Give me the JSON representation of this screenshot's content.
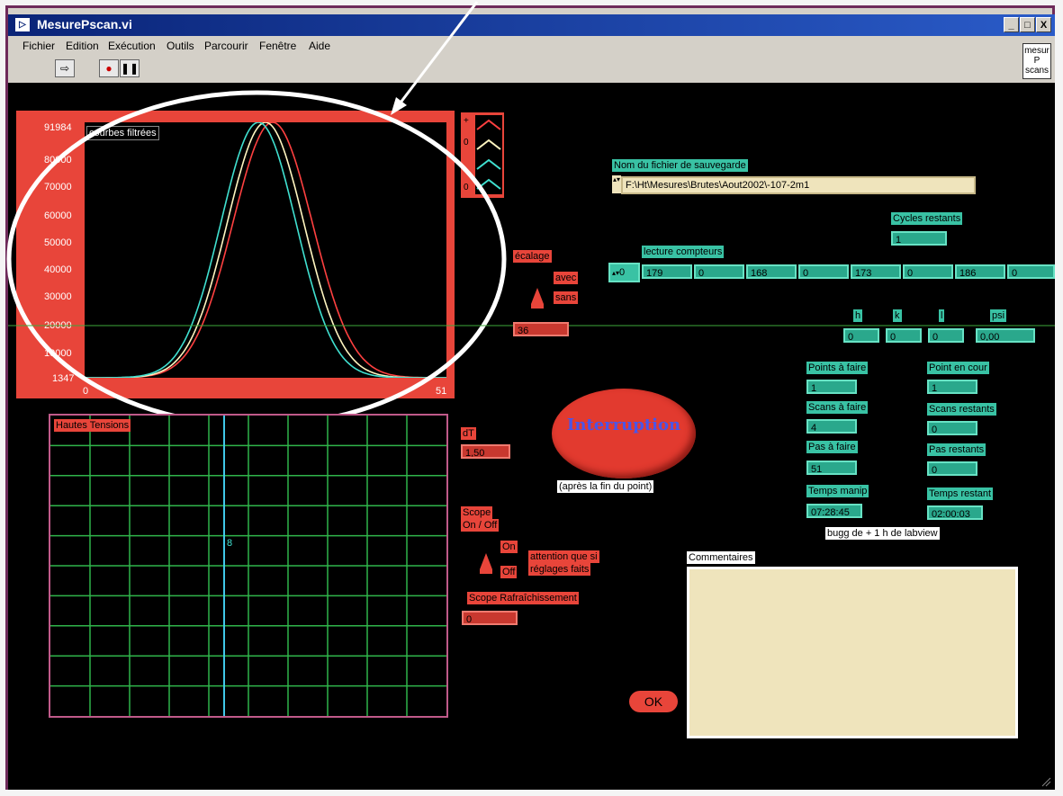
{
  "window": {
    "title": "MesurePscan.vi",
    "minimize_label": "_",
    "maximize_label": "□",
    "close_label": "X"
  },
  "menu": [
    "Fichier",
    "Edition",
    "Exécution",
    "Outils",
    "Parcourir",
    "Fenêtre",
    "Aide"
  ],
  "toolbar": {
    "run_icon": "run-arrow-icon",
    "abort_icon": "abort-icon",
    "pause_icon": "pause-icon",
    "vi_icon_text": [
      "mesur",
      "P",
      "scans"
    ]
  },
  "graph": {
    "title": "courbes filtrées",
    "y_ticks": [
      "91984",
      "80000",
      "70000",
      "60000",
      "50000",
      "40000",
      "30000",
      "20000",
      "10000",
      "1347"
    ],
    "x_ticks": [
      "0",
      "51"
    ],
    "legend_values": [
      "+",
      "0",
      "",
      "0"
    ]
  },
  "chart_data": {
    "type": "line",
    "title": "courbes filtrées",
    "xlim": [
      0,
      51
    ],
    "ylim": [
      1347,
      91984
    ],
    "series": [
      {
        "color": "#ff4040",
        "center": 26.5,
        "width": 5.6
      },
      {
        "color": "#fff5c0",
        "center": 25.5,
        "width": 5.4
      },
      {
        "color": "#40e0d0",
        "center": 24.5,
        "width": 5.3
      }
    ],
    "peak": 91984,
    "baseline": 1347
  },
  "hv": {
    "title": "Hautes Tensions",
    "marker_text": "8"
  },
  "decalage": {
    "label": "écalage",
    "avec": "avec",
    "sans": "sans",
    "value": "36"
  },
  "dt": {
    "label": "dT",
    "value": "1,50"
  },
  "scope": {
    "label_line1": "Scope",
    "label_line2": "On / Off",
    "on": "On",
    "off": "Off",
    "note_line1": "attention que si",
    "note_line2": "réglages faits",
    "refresh_label": "Scope Rafraîchissement",
    "refresh_value": "0"
  },
  "interruption": {
    "label": "Interruption",
    "sub": "(après la fin du point)"
  },
  "ok_label": "OK",
  "file": {
    "label": "Nom du fichier de sauvegarde",
    "path": "F:\\Ht\\Mesures\\Brutes\\Aout2002\\-107-2m1"
  },
  "cycles": {
    "label": "Cycles restants",
    "value": "1"
  },
  "compteurs": {
    "label": "lecture compteurs",
    "index": "0",
    "values": [
      "179",
      "0",
      "168",
      "0",
      "173",
      "0",
      "186",
      "0"
    ]
  },
  "hkl": {
    "labels": [
      "h",
      "k",
      "l",
      "psi"
    ],
    "values": [
      "0",
      "0",
      "0",
      "0,00"
    ]
  },
  "status": {
    "points_a_faire": {
      "label": "Points à faire",
      "value": "1"
    },
    "point_en_cour": {
      "label": "Point en cour",
      "value": "1"
    },
    "scans_a_faire": {
      "label": "Scans à faire",
      "value": "4"
    },
    "scans_restants": {
      "label": "Scans restants",
      "value": "0"
    },
    "pas_a_faire": {
      "label": "Pas à faire",
      "value": "51"
    },
    "pas_restants": {
      "label": "Pas restants",
      "value": "0"
    },
    "temps_manip": {
      "label": "Temps manip",
      "value": "07:28:45"
    },
    "temps_restant": {
      "label": "Temps restant",
      "value": "02:00:03"
    },
    "bugg_note": "bugg de + 1 h de labview"
  },
  "commentaires": {
    "label": "Commentaires",
    "value": ""
  },
  "colors": {
    "panel_bg": "#000000",
    "graph_frame": "#e8453a",
    "teal": "#39c2a4",
    "annotation": "#ffffff"
  }
}
